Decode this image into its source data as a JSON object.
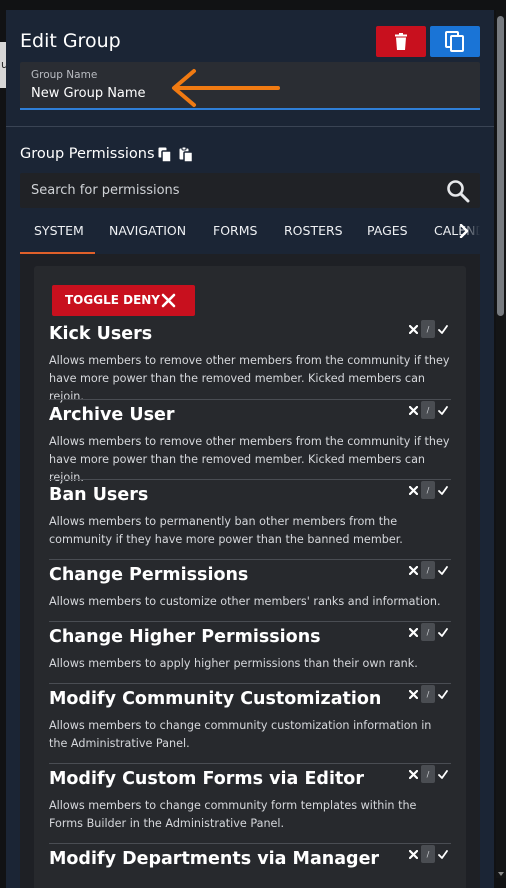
{
  "background_sliver_text": "u",
  "modal": {
    "title": "Edit Group",
    "colors": {
      "delete": "#c8101e",
      "copy": "#1a74d6",
      "accent_tab": "#e0602a",
      "annotation_arrow": "#f07a12"
    }
  },
  "group_name": {
    "label": "Group Name",
    "value": "New Group Name"
  },
  "permissions_header": {
    "title": "Group Permissions"
  },
  "search": {
    "placeholder": "Search for permissions"
  },
  "tabs": [
    "SYSTEM",
    "NAVIGATION",
    "FORMS",
    "ROSTERS",
    "PAGES",
    "CALEND"
  ],
  "toggle_deny_label": "TOGGLE DENY",
  "tri_state_neutral": "/",
  "permissions": [
    {
      "name": "Kick Users",
      "description": "Allows members to remove other members from the community if they have more power than the removed member. Kicked members can rejoin."
    },
    {
      "name": "Archive User",
      "description": "Allows members to remove other members from the community if they have more power than the removed member. Kicked members can rejoin."
    },
    {
      "name": "Ban Users",
      "description": "Allows members to permanently ban other members from the community if they have more power than the banned member."
    },
    {
      "name": "Change Permissions",
      "description": "Allows members to customize other members' ranks and information."
    },
    {
      "name": "Change Higher Permissions",
      "description": "Allows members to apply higher permissions than their own rank."
    },
    {
      "name": "Modify Community Customization",
      "description": "Allows members to change community customization information in the Administrative Panel."
    },
    {
      "name": "Modify Custom Forms via Editor",
      "description": "Allows members to change community form templates within the Forms Builder in the Administrative Panel."
    },
    {
      "name": "Modify Departments via Manager",
      "description": ""
    }
  ]
}
